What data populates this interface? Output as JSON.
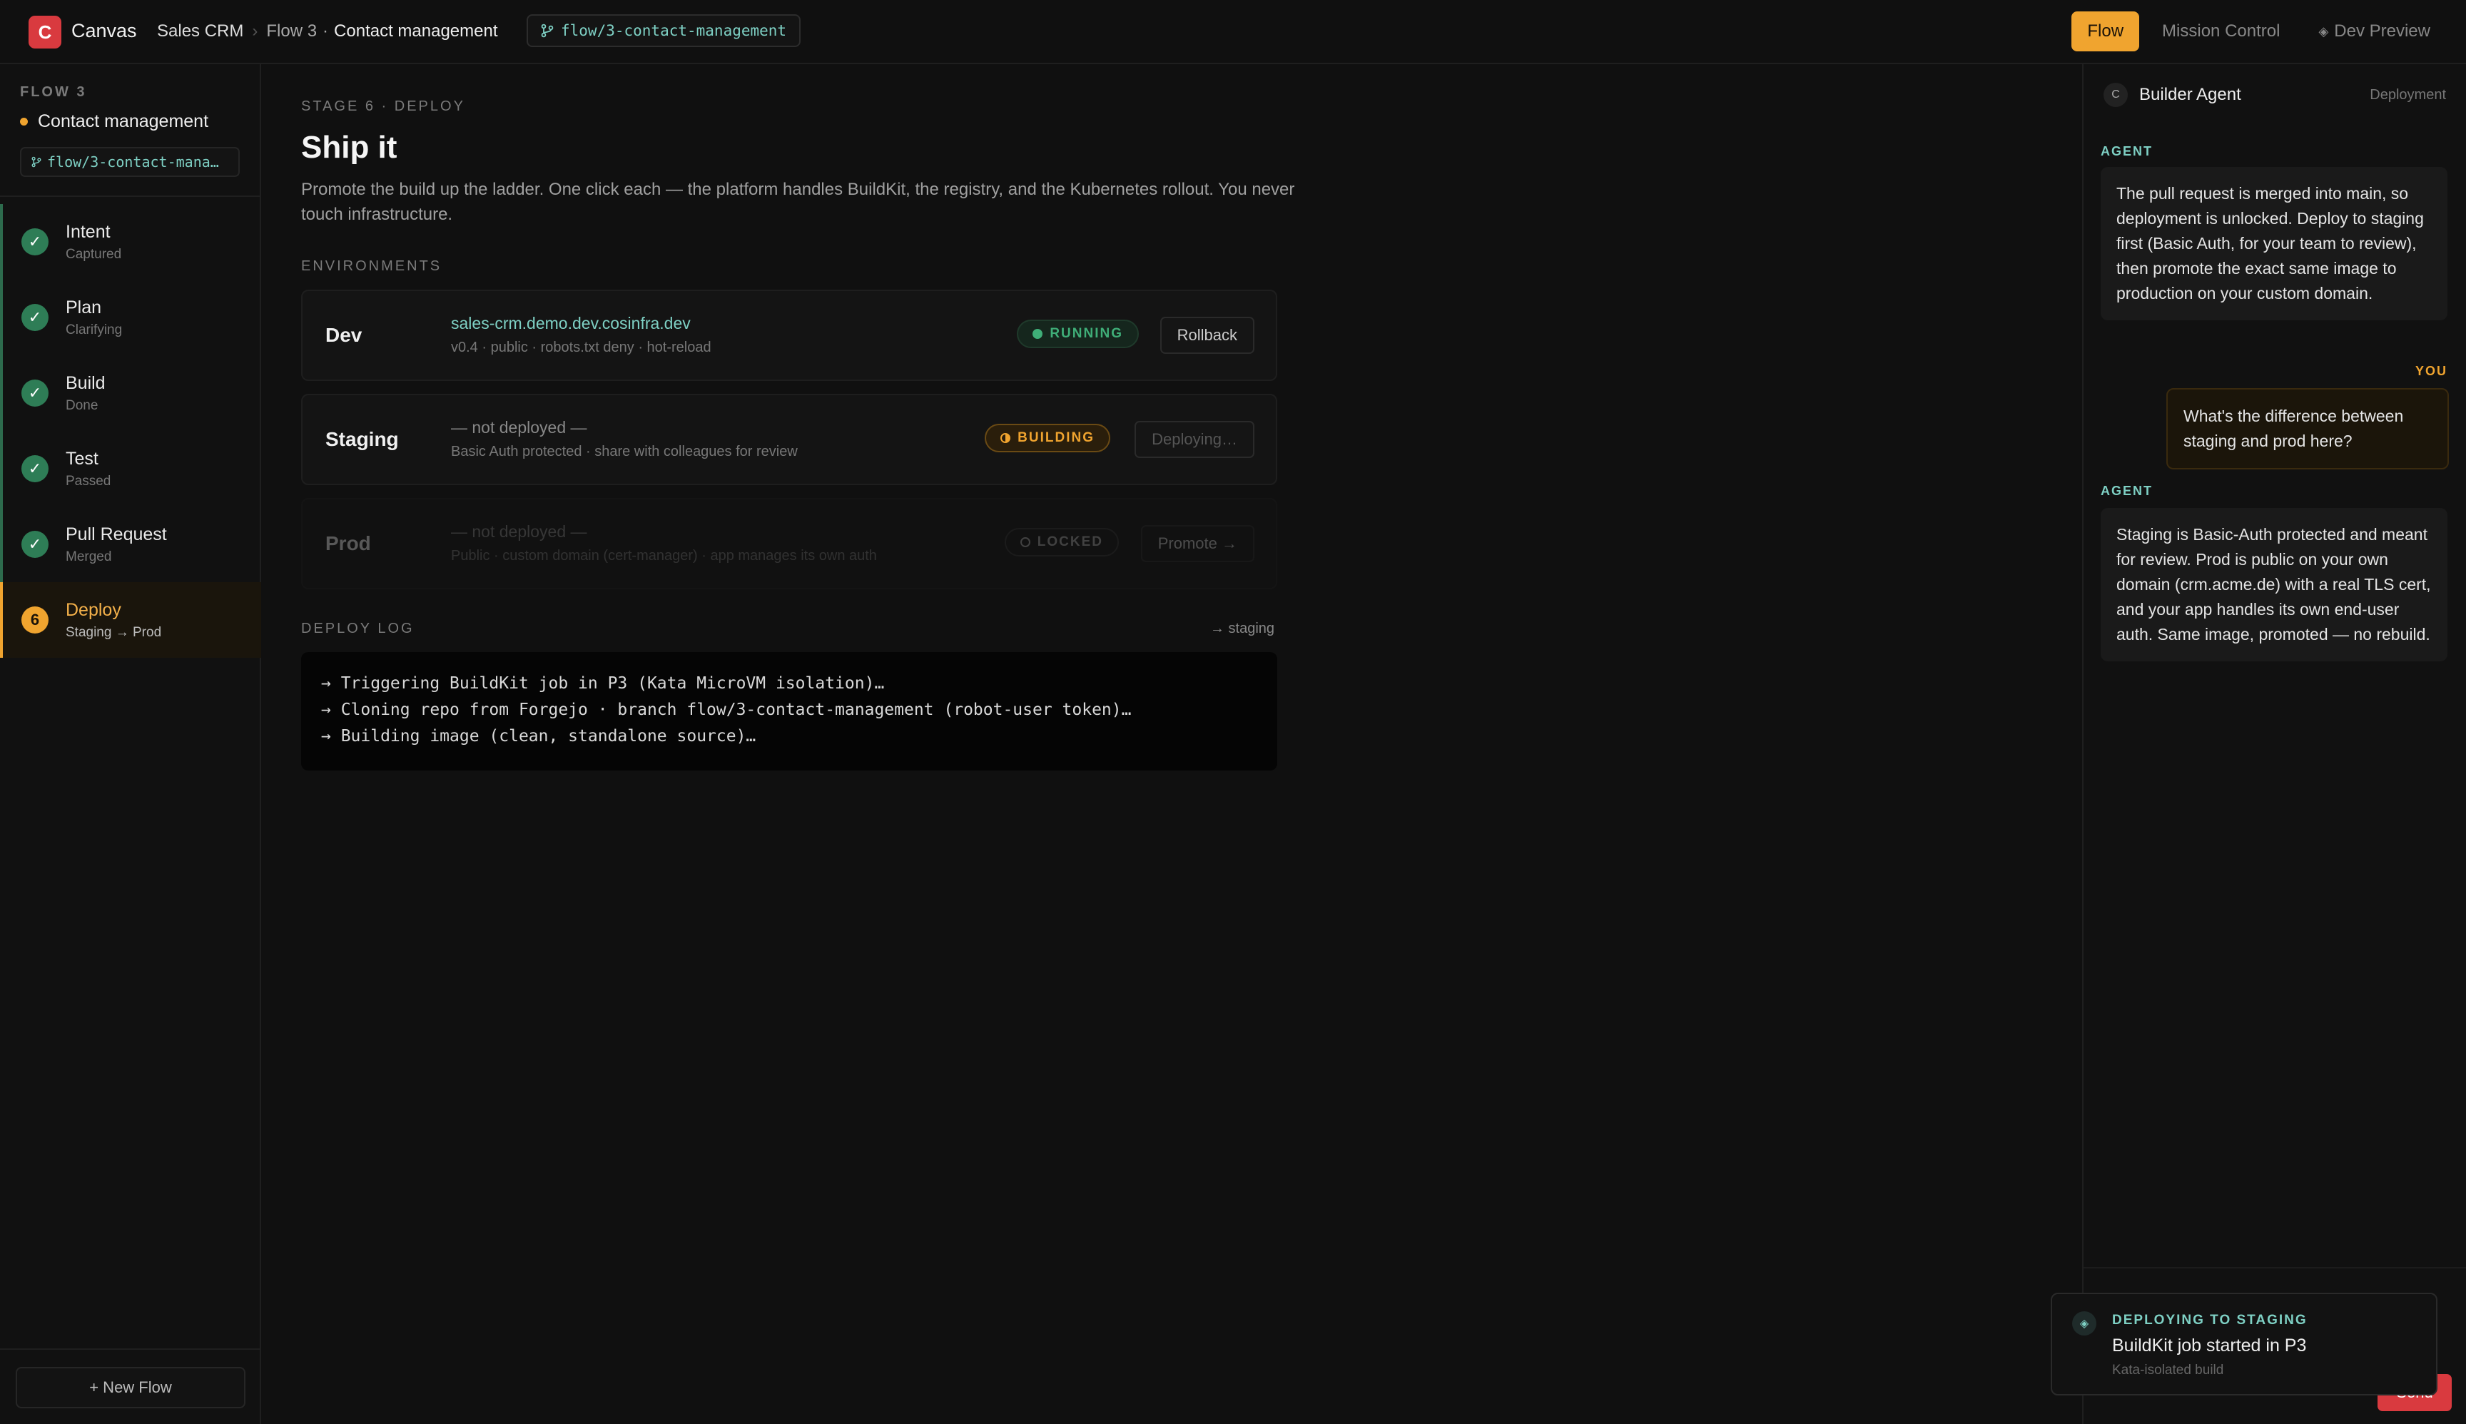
{
  "app": {
    "logo_letter": "C",
    "name": "Canvas"
  },
  "breadcrumb": {
    "project": "Sales CRM",
    "sep": "›",
    "flow": "Flow 3",
    "dot": "·",
    "current": "Contact management"
  },
  "branch": "flow/3-contact-management",
  "modes": [
    {
      "label": "Flow",
      "active": true
    },
    {
      "label": "Mission Control",
      "active": false
    },
    {
      "label": "Dev Preview",
      "icon": "◈"
    }
  ],
  "sidebar": {
    "flow_label": "FLOW 3",
    "flow_title": "Contact management",
    "branch_short": "flow/3-contact-mana…",
    "steps": [
      {
        "name": "Intent",
        "status": "Captured",
        "badge": "✓"
      },
      {
        "name": "Plan",
        "status": "Clarifying",
        "badge": "✓"
      },
      {
        "name": "Build",
        "status": "Done",
        "badge": "✓"
      },
      {
        "name": "Test",
        "status": "Passed",
        "badge": "✓"
      },
      {
        "name": "Pull Request",
        "status": "Merged",
        "badge": "✓"
      },
      {
        "name": "Deploy",
        "status": "Staging → Prod",
        "badge": "6"
      }
    ],
    "new_flow": "+ New Flow"
  },
  "main": {
    "stage": "STAGE 6 · DEPLOY",
    "title": "Ship it",
    "description": "Promote the build up the ladder. One click each — the platform handles BuildKit, the registry, and the Kubernetes rollout. You never touch infrastructure.",
    "env_label": "ENVIRONMENTS",
    "envs": [
      {
        "name": "Dev",
        "url": "sales-crm.demo.dev.cosinfra.dev",
        "meta": "v0.4 · public · robots.txt deny · hot-reload",
        "status": "RUNNING",
        "action": "Rollback"
      },
      {
        "name": "Staging",
        "url": "— not deployed —",
        "meta": "Basic Auth protected · share with colleagues for review",
        "status": "BUILDING",
        "action": "Deploying…"
      },
      {
        "name": "Prod",
        "url": "— not deployed —",
        "meta": "Public · custom domain (cert-manager) · app manages its own auth",
        "status": "LOCKED",
        "action": "Promote →"
      }
    ],
    "log_label": "DEPLOY LOG",
    "log_target": "→ staging",
    "log": [
      "→ Triggering BuildKit job in P3 (Kata MicroVM isolation)…",
      "→ Cloning repo from Forgejo · branch flow/3-contact-management (robot-user token)…",
      "→ Building image (clean, standalone source)…"
    ]
  },
  "panel": {
    "avatar": "C",
    "agent_name": "Builder Agent",
    "context": "Deployment",
    "agent_label": "AGENT",
    "you_label": "YOU",
    "messages": [
      "The pull request is merged into main, so deployment is unlocked. Deploy to staging first (Basic Auth, for your team to review), then promote the exact same image to production on your custom domain.",
      "What's the difference between staging and prod here?",
      "Staging is Basic-Auth protected and meant for review. Prod is public on your own domain (crm.acme.de) with a real TLS cert, and your app handles its own end-user auth. Same image, promoted — no rebuild."
    ],
    "send": "Send"
  },
  "toast": {
    "icon": "◈",
    "title": "DEPLOYING TO STAGING",
    "message": "BuildKit job started in P3",
    "sub": "Kata-isolated build"
  },
  "colors": {
    "accent": "#f0a42f",
    "brand": "#d93a3f",
    "success": "#3fae78",
    "teal": "#7ed0c4"
  }
}
